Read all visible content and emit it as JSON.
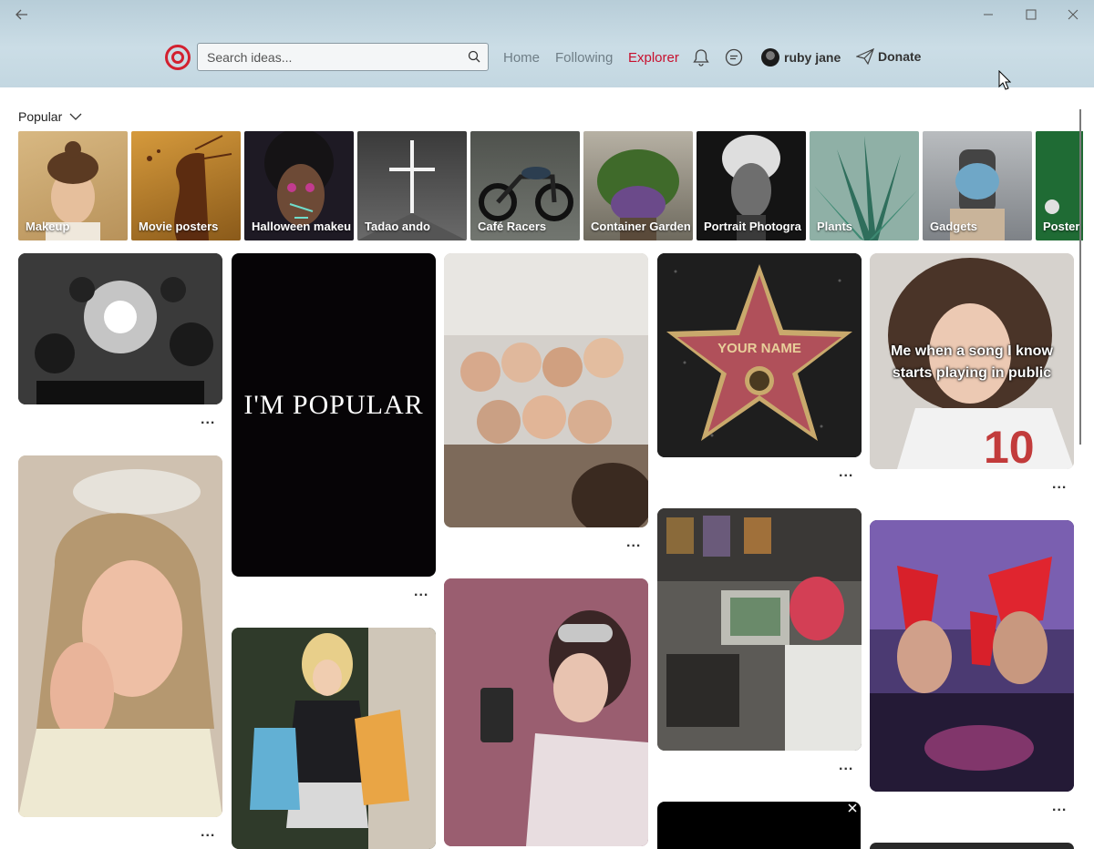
{
  "window": {
    "back_icon": "arrow-left-icon",
    "minimize_icon": "minimize-icon",
    "maximize_icon": "maximize-icon",
    "close_icon": "close-icon"
  },
  "nav": {
    "search_placeholder": "Search ideas...",
    "links": [
      "Home",
      "Following",
      "Explorer"
    ],
    "active": "Explorer",
    "user_name": "ruby jane",
    "donate_label": "Donate",
    "accent": "#c8102e"
  },
  "section": {
    "title": "Popular"
  },
  "categories": [
    {
      "label": "Makeup",
      "color": "#c9a56a"
    },
    {
      "label": "Movie posters",
      "color": "#b47d2a"
    },
    {
      "label": "Halloween makeu",
      "color": "#2a2030"
    },
    {
      "label": "Tadao ando",
      "color": "#4a4a4a"
    },
    {
      "label": "Café Racers",
      "color": "#5a5f58"
    },
    {
      "label": "Container Garden",
      "color": "#5d6e3e"
    },
    {
      "label": "Portrait Photogra",
      "color": "#2b2b2b"
    },
    {
      "label": "Plants",
      "color": "#3f7a6b"
    },
    {
      "label": "Gadgets",
      "color": "#6b6f74"
    },
    {
      "label": "Poster d",
      "color": "#1f6b34"
    }
  ],
  "pins": {
    "im_popular": "I'M POPULAR",
    "your_name": "YOUR NAME",
    "meme": "Me when a song I know starts playing in public",
    "more_label": "..."
  }
}
